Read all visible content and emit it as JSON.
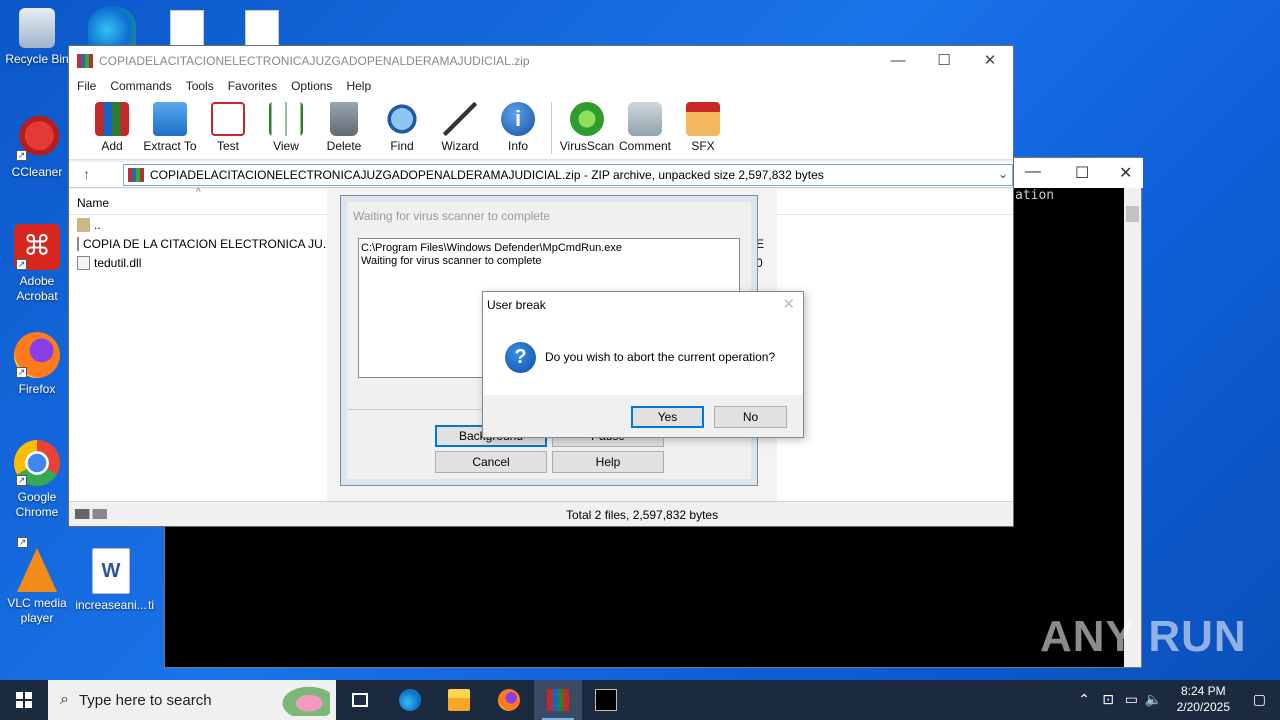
{
  "desktop": {
    "icons": [
      {
        "label": "Recycle Bin"
      },
      {
        "label": "CCleaner"
      },
      {
        "label": "Adobe Acrobat"
      },
      {
        "label": "Firefox"
      },
      {
        "label": "Google Chrome"
      },
      {
        "label": "VLC media player"
      },
      {
        "label": "increaseani..."
      },
      {
        "label": "ti"
      }
    ]
  },
  "console": {
    "text": "ation"
  },
  "winrar": {
    "title": "COPIADELACITACIONELECTRONICAJUZGADOPENALDERAMAJUDICIAL.zip",
    "menu": [
      "File",
      "Commands",
      "Tools",
      "Favorites",
      "Options",
      "Help"
    ],
    "toolbar": [
      "Add",
      "Extract To",
      "Test",
      "View",
      "Delete",
      "Find",
      "Wizard",
      "Info",
      "VirusScan",
      "Comment",
      "SFX"
    ],
    "address": "COPIADELACITACIONELECTRONICAJUZGADOPENALDERAMAJUDICIAL.zip - ZIP archive, unpacked size 2,597,832 bytes",
    "column_name": "Name",
    "files": [
      {
        "name": ".."
      },
      {
        "name": "COPIA DE LA CITACION ELECTRONICA JU..."
      },
      {
        "name": "tedutil.dll"
      }
    ],
    "col_fragments": [
      "E",
      "0"
    ],
    "status": "Total 2 files, 2,597,832 bytes"
  },
  "virus_dialog": {
    "title": "Waiting for virus scanner to complete",
    "log_line1": "C:\\Program Files\\Windows Defender\\MpCmdRun.exe",
    "log_line2": "Waiting for virus scanner to complete",
    "background_label": "Background",
    "pause_label": "Pause",
    "cancel_label": "Cancel",
    "help_label": "Help"
  },
  "user_break": {
    "title": "User break",
    "message": "Do you wish to abort the current operation?",
    "yes_label": "Yes",
    "no_label": "No"
  },
  "watermark": "ANY RUN",
  "taskbar": {
    "search_placeholder": "Type here to search",
    "time": "8:24 PM",
    "date": "2/20/2025"
  }
}
